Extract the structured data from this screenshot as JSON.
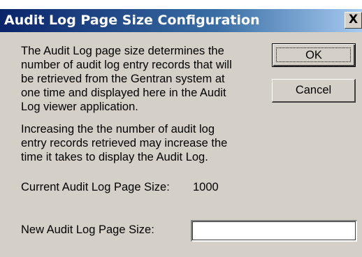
{
  "window": {
    "title": "Audit Log Page Size Configuration",
    "close_glyph": "X"
  },
  "content": {
    "description": "The Audit Log page size determines the\nnumber of audit log entry records that will\nbe retrieved from the Gentran system at\none time and displayed here in the Audit\nLog viewer application.",
    "warning": "Increasing the the number of audit log\nentry records retrieved may increase the\ntime it takes to display the Audit Log.",
    "current_label": "Current Audit Log Page Size:",
    "current_value": "1000",
    "new_label": "New Audit Log Page Size:",
    "new_value": ""
  },
  "buttons": {
    "ok_label": "OK",
    "cancel_label": "Cancel"
  },
  "colors": {
    "titlebar_start": "#0a246a",
    "titlebar_end": "#a6caf0",
    "dialog_face": "#d4d0c8"
  }
}
